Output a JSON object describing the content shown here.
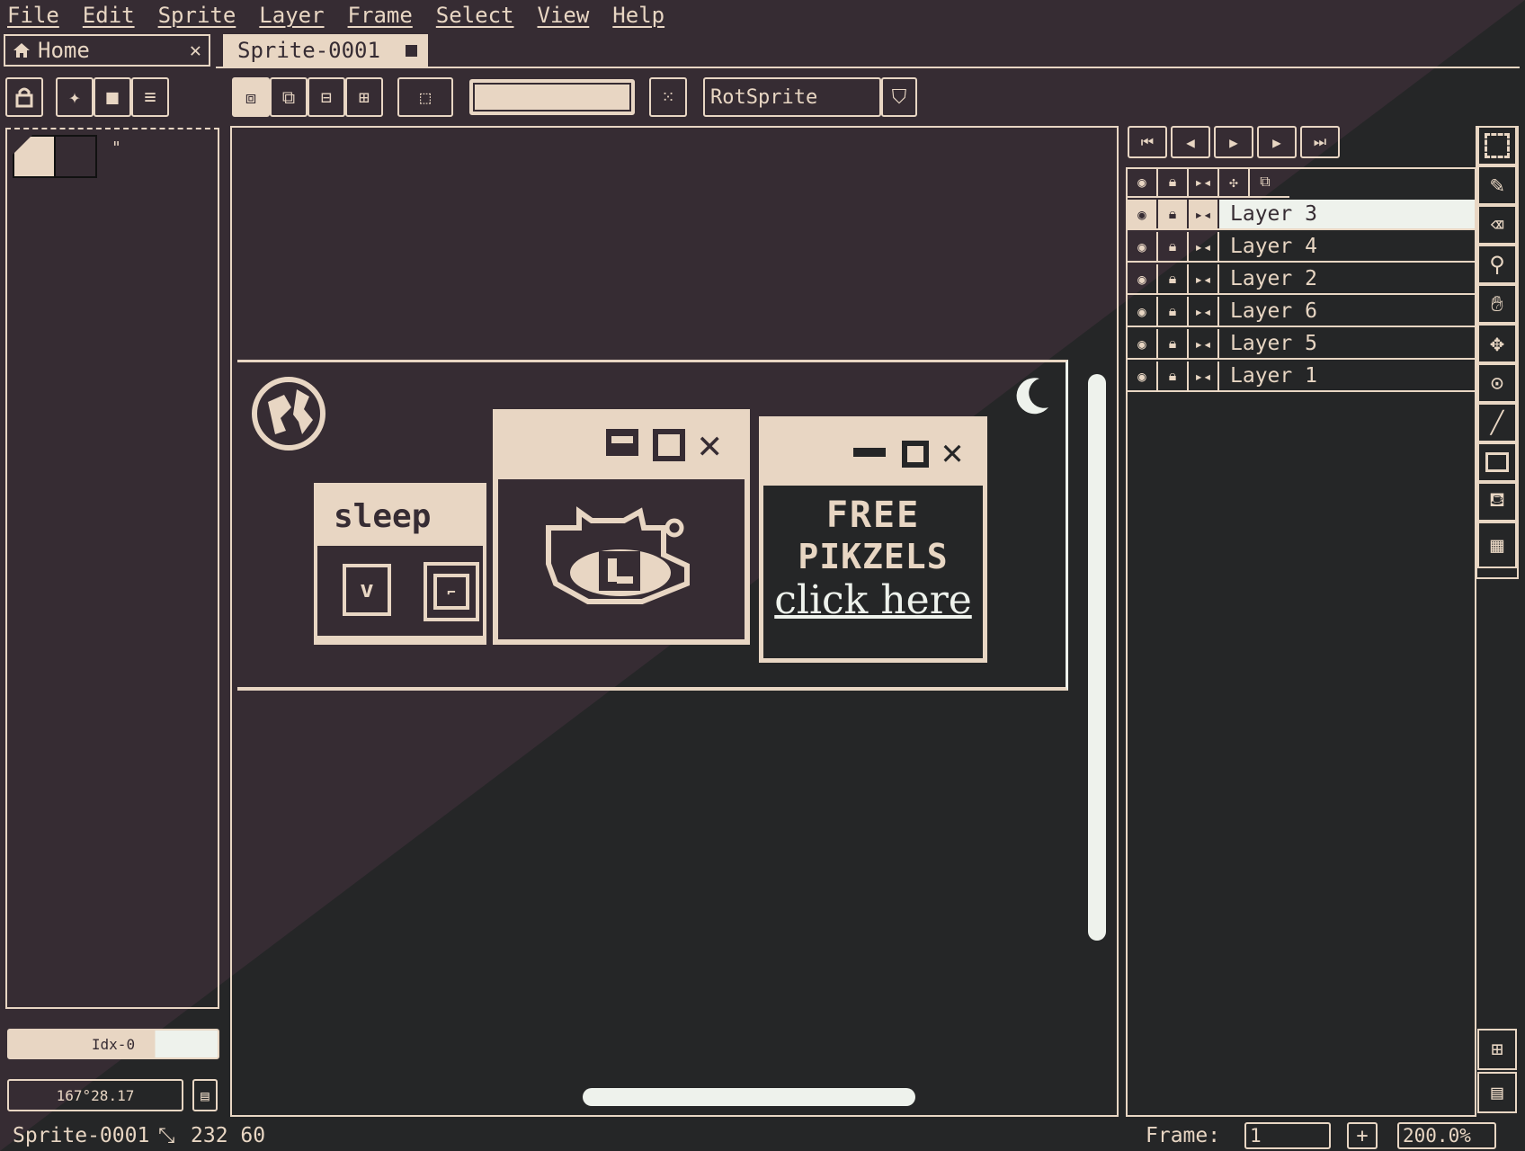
{
  "colors": {
    "dark": "#362c33",
    "cream": "#e8d6c3",
    "mint": "#eef2ec",
    "charcoal": "#252627"
  },
  "menu": [
    "File",
    "Edit",
    "Sprite",
    "Layer",
    "Frame",
    "Select",
    "View",
    "Help"
  ],
  "tabs": {
    "home": "Home",
    "sprite": "Sprite-0001"
  },
  "toolbar": {
    "rotation_algorithm": "RotSprite"
  },
  "palette": {
    "index_label": "Idx-0",
    "color_value": "167°28.17"
  },
  "timeline": {
    "layers": [
      "Layer 3",
      "Layer 4",
      "Layer 2",
      "Layer 6",
      "Layer 5",
      "Layer 1"
    ],
    "active_layer": "Layer 3"
  },
  "artwork": {
    "sleep_label": "sleep",
    "ad_line1": "FREE",
    "ad_line2": "PIKZELS",
    "ad_link": "click here"
  },
  "status": {
    "sprite_name": "Sprite-0001",
    "size": "232 60",
    "frame_label": "Frame:",
    "frame_value": "1",
    "zoom": "200.0%"
  }
}
